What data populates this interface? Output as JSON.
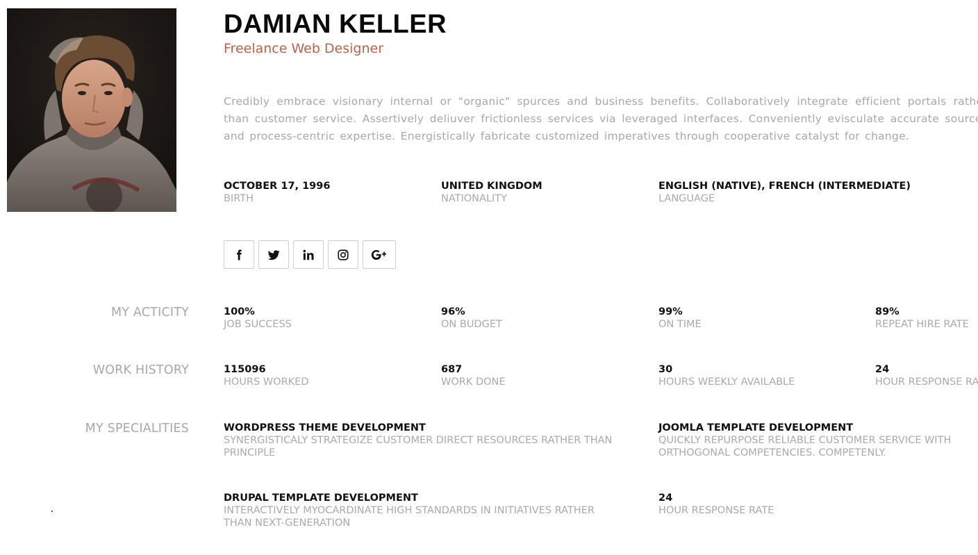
{
  "profile": {
    "name": "DAMIAN KELLER",
    "role": "Freelance Web Designer",
    "bio": "Credibly embrace visionary internal or \"organic\" spurces and business benefits. Collaboratively integrate efficient portals rather than customer service. Assertively deliuver frictionless services via leveraged interfaces. Conveniently evisculate accurate sources and process-centric expertise. Energistically fabricate customized imperatives through cooperative catalyst for change."
  },
  "info": [
    {
      "value": "OCTOBER 17, 1996",
      "label": "BIRTH"
    },
    {
      "value": "UNITED KINGDOM",
      "label": "NATIONALITY"
    },
    {
      "value": "ENGLISH (NATIVE), FRENCH (INTERMEDIATE)",
      "label": "LANGUAGE"
    }
  ],
  "social": [
    {
      "icon": "facebook-icon"
    },
    {
      "icon": "twitter-icon"
    },
    {
      "icon": "linkedin-icon"
    },
    {
      "icon": "instagram-icon"
    },
    {
      "icon": "google-plus-icon"
    }
  ],
  "activity": {
    "title": "MY ACTICITY",
    "items": [
      {
        "value": "100%",
        "label": "JOB SUCCESS"
      },
      {
        "value": "96%",
        "label": "ON BUDGET"
      },
      {
        "value": "99%",
        "label": "ON TIME"
      },
      {
        "value": "89%",
        "label": "REPEAT HIRE RATE"
      }
    ]
  },
  "history": {
    "title": "WORK HISTORY",
    "items": [
      {
        "value": "115096",
        "label": "HOURS WORKED"
      },
      {
        "value": "687",
        "label": "WORK DONE"
      },
      {
        "value": "30",
        "label": "HOURS WEEKLY AVAILABLE"
      },
      {
        "value": "24",
        "label": "HOUR RESPONSE RATE"
      }
    ]
  },
  "specialities": {
    "title": "MY SPECIALITIES",
    "items": [
      {
        "value": "WORDPRESS THEME DEVELOPMENT",
        "label": "SYNERGISTICALY STRATEGIZE CUSTOMER DIRECT RESOURCES RATHER THAN PRINCIPLE"
      },
      {
        "value": "JOOMLA TEMPLATE DEVELOPMENT",
        "label": "QUICKLY REPURPOSE RELIABLE CUSTOMER SERVICE WITH ORTHOGONAL COMPETENCIES. COMPETENLY."
      },
      {
        "value": "DRUPAL TEMPLATE DEVELOPMENT",
        "label": "INTERACTIVELY MYOCARDINATE HIGH STANDARDS IN INITIATIVES RATHER THAN NEXT-GENERATION"
      },
      {
        "value": "24",
        "label": "HOUR RESPONSE RATE"
      }
    ]
  }
}
